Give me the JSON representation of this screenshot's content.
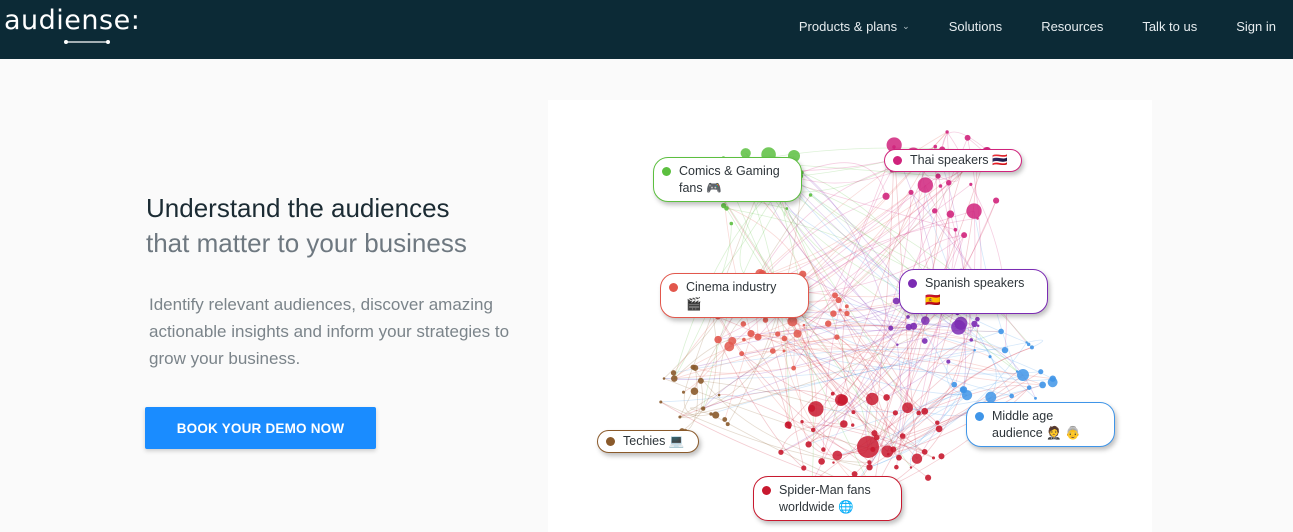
{
  "brand": {
    "logo_text": "audiense:"
  },
  "nav": {
    "items": [
      {
        "label": "Products & plans",
        "has_dropdown": true
      },
      {
        "label": "Solutions"
      },
      {
        "label": "Resources"
      },
      {
        "label": "Talk to us"
      },
      {
        "label": "Sign in"
      }
    ],
    "background": "#0c2a36"
  },
  "hero": {
    "headline": "Understand the audiences",
    "subheadline": "that matter to your business",
    "body": "Identify relevant audiences, discover amazing actionable insights and inform your strategies to grow your business.",
    "cta_label": "BOOK YOUR DEMO NOW",
    "cta_color": "#1a8cff"
  },
  "graph": {
    "clusters": [
      {
        "id": "comics",
        "label": "Comics & Gaming\nfans 🎮",
        "color": "#5cbf3f"
      },
      {
        "id": "thai",
        "label": "Thai speakers 🇹🇭",
        "color": "#d0237c"
      },
      {
        "id": "cinema",
        "label": "Cinema industry\n🎬",
        "color": "#e2574c"
      },
      {
        "id": "spanish",
        "label": "Spanish speakers\n🇪🇸",
        "color": "#7b2bb3"
      },
      {
        "id": "techies",
        "label": "Techies 💻",
        "color": "#8a5a2b"
      },
      {
        "id": "middle",
        "label": "Middle age\naudience 🤵 👵",
        "color": "#3f95e8"
      },
      {
        "id": "spiderman",
        "label": "Spider-Man fans\nworldwide 🌐",
        "color": "#c8192f"
      }
    ]
  }
}
